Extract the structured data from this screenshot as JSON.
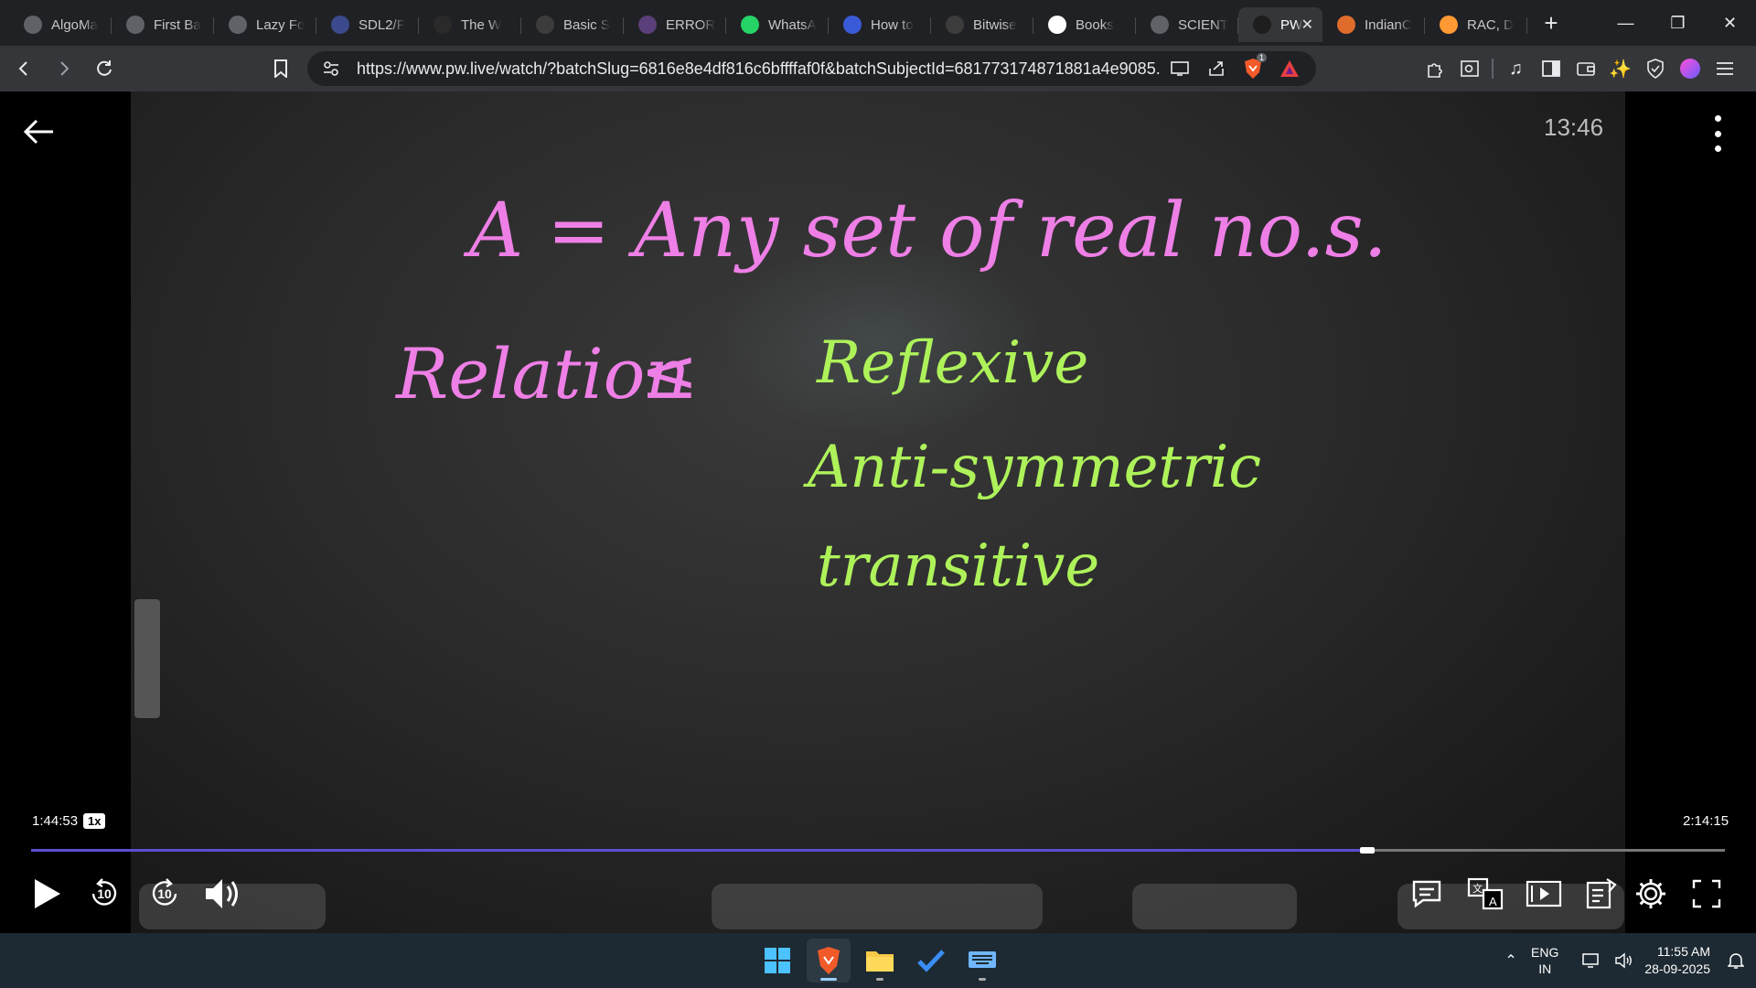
{
  "browser": {
    "tabs": [
      {
        "label": "AlgoMa",
        "icon": "algomaster-icon",
        "color": "#5f6368"
      },
      {
        "label": "First Ba",
        "icon": "spiral-logo-icon",
        "color": "#5f6368"
      },
      {
        "label": "Lazy Fo",
        "icon": "spiral-logo-icon",
        "color": "#5f6368"
      },
      {
        "label": "SDL2/F",
        "icon": "sdl-icon",
        "color": "#3b4a8c"
      },
      {
        "label": "The W",
        "icon": "wordpress-icon",
        "color": "#2a2a2a"
      },
      {
        "label": "Basic S",
        "icon": "text-doc-icon",
        "color": "#3c3c3c"
      },
      {
        "label": "ERROR",
        "icon": "error-site-icon",
        "color": "#5b3f7a"
      },
      {
        "label": "WhatsA",
        "icon": "whatsapp-icon",
        "color": "#25d366"
      },
      {
        "label": "How to",
        "icon": "bookmark-pin-icon",
        "color": "#3a5bd9"
      },
      {
        "label": "Bitwise",
        "icon": "orfg-site-icon",
        "color": "#3c3c3c"
      },
      {
        "label": "Books",
        "icon": "google-icon",
        "color": "#ffffff"
      },
      {
        "label": "SCIENT",
        "icon": "globe-icon",
        "color": "#5f6368"
      },
      {
        "label": "PW",
        "icon": "pw-logo-icon",
        "color": "#1e1e1e",
        "active": true
      },
      {
        "label": "IndianC",
        "icon": "indian-site-icon",
        "color": "#e06c2b"
      },
      {
        "label": "RAC, D",
        "icon": "india-flag-icon",
        "color": "#ff9933"
      }
    ],
    "url": "https://www.pw.live/watch/?batchSlug=6816e8e4df816c6bffffaf0f&batchSubjectId=681773174871881a4e9085...",
    "shields_count": "1"
  },
  "player": {
    "overlay_time": "13:46",
    "current_time": "1:44:53",
    "speed": "1x",
    "total_time": "2:14:15",
    "progress_fraction": 0.789,
    "rewind_seconds": "10",
    "forward_seconds": "10"
  },
  "board": {
    "line1": "A = Any set of real no.s.",
    "line2_left": "Relation",
    "line2_symbol": "≤",
    "properties": [
      "Reflexive",
      "Anti-symmetric",
      "transitive"
    ],
    "pink": "#ee7fe6",
    "green": "#aef25a"
  },
  "taskbar": {
    "lang_line1": "ENG",
    "lang_line2": "IN",
    "time": "11:55 AM",
    "date": "28-09-2025"
  }
}
